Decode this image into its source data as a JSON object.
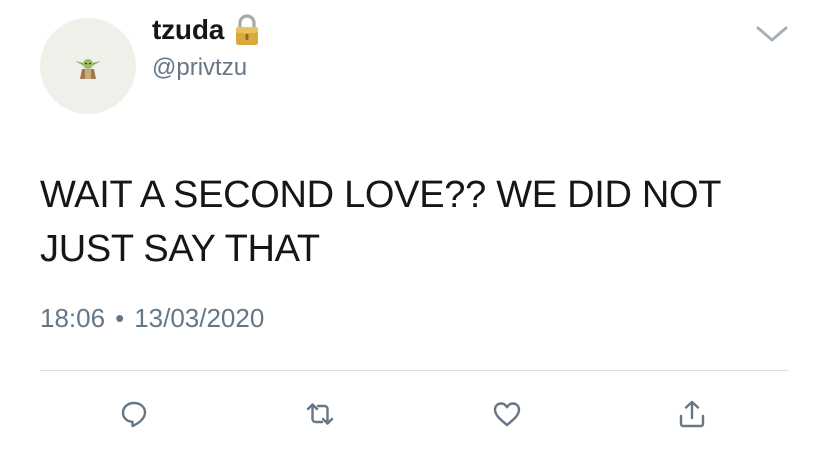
{
  "author": {
    "display_name": "tzuda",
    "handle": "@privtzu",
    "avatar_icon": "yoda-avatar-icon",
    "protected_icon": "lock-icon"
  },
  "tweet": {
    "text": "WAIT A SECOND LOVE?? WE DID NOT JUST SAY THAT",
    "time": "18:06",
    "separator": "•",
    "date": "13/03/2020"
  },
  "actions": {
    "reply_icon": "reply-icon",
    "retweet_icon": "retweet-icon",
    "like_icon": "heart-icon",
    "share_icon": "share-icon"
  },
  "colors": {
    "text": "#14171a",
    "secondary": "#657786",
    "divider": "#d8dde2",
    "avatar_bg": "#eef0e9"
  }
}
